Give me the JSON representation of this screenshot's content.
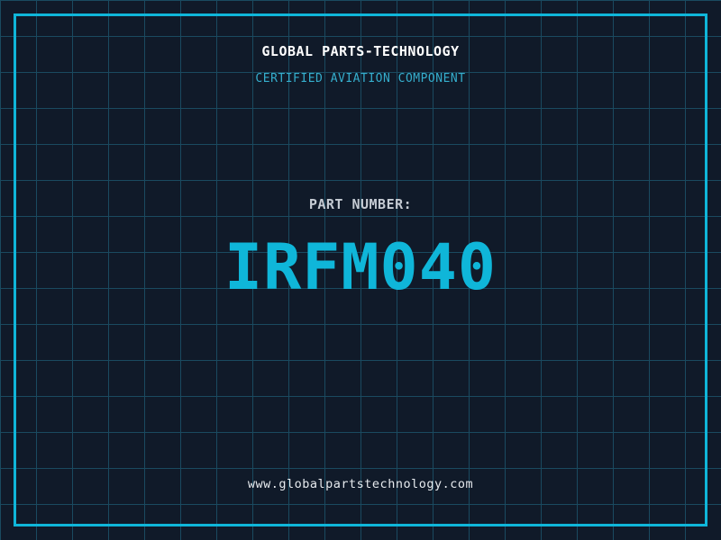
{
  "brand": {
    "title": "GLOBAL PARTS-TECHNOLOGY",
    "subtitle": "CERTIFIED AVIATION COMPONENT"
  },
  "part": {
    "label": "PART NUMBER:",
    "number": "IRFM040"
  },
  "footer": {
    "website": "www.globalpartstechnology.com"
  },
  "colors": {
    "background": "#101a29",
    "grid_line": "#1a4a60",
    "accent": "#0fb6d9",
    "subtitle": "#35aecd",
    "title": "#ffffff",
    "label": "#c5cbd3",
    "footer_text": "#e6eaee"
  }
}
